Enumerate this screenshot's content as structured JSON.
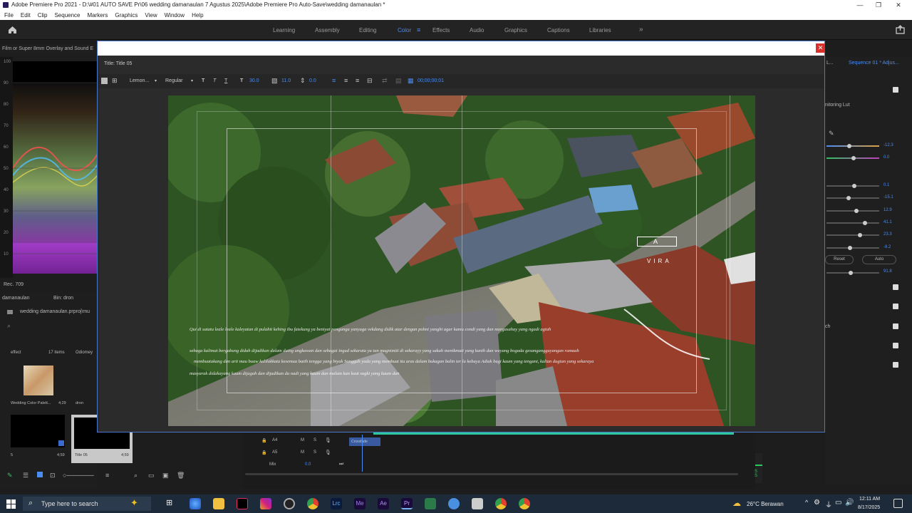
{
  "window": {
    "title": "Adobe Premiere Pro 2021 - D:\\#01 AUTO SAVE Pr\\06 wedding damanaulan  7 Agustus 2025\\Adobe Premiere Pro Auto-Save\\wedding damanaulan *",
    "minimize": "—",
    "restore": "❐",
    "close": "✕"
  },
  "menu": [
    "File",
    "Edit",
    "Clip",
    "Sequence",
    "Markers",
    "Graphics",
    "View",
    "Window",
    "Help"
  ],
  "workspaces": {
    "items": [
      "Learning",
      "Assembly",
      "Editing",
      "Color",
      "Effects",
      "Audio",
      "Graphics",
      "Captions",
      "Libraries"
    ],
    "active": "Color",
    "more": "»"
  },
  "scopes": {
    "header": "Film or Super 8mm Overlay and Sound E",
    "axis": [
      "100",
      "90",
      "80",
      "70",
      "60",
      "50",
      "40",
      "30",
      "20",
      "10"
    ],
    "footer": "Rec. 709"
  },
  "project": {
    "header": "damanaulan",
    "bin_tab": "Bin: dron",
    "path": "wedding damanaulan.prproj\\mu",
    "bin_name": "effect",
    "item_count": "17 items",
    "clip1_name": "Wedding Color Palett...",
    "clip1_dur": "4;29",
    "clip2_name": "dron",
    "clip3_name": "Title 05",
    "clip3_dur": "4;59",
    "clip4_name": "Odiomey",
    "clip4_dur": "4;59",
    "clip_label": "5"
  },
  "right": {
    "sequence": "Sequence 01 * Adjus...",
    "lut_label": "nitoring Lut",
    "values": [
      "-12.3",
      "0.0",
      "0.1",
      "-15.1",
      "12.9",
      "41.1",
      "23.3",
      "-8.2"
    ],
    "reset": "Reset",
    "auto": "Auto",
    "last_val": "91.8",
    "side_label": "ch"
  },
  "timeline": {
    "tracks": [
      "A4",
      "A5",
      "Mix"
    ],
    "mix_value": "0.0",
    "clip_label": "Crossfade",
    "meter": "S S"
  },
  "dialog": {
    "title": "Title: Title 05",
    "font": "Lemon...",
    "style": "Regular",
    "size": "30.0",
    "kerning": "11.0",
    "leading": "0.0",
    "timecode": "00;00;00;01",
    "logo_lines": [
      "A",
      "VIRA"
    ],
    "credits": [
      "Qui di satatu leale leale kaleyatan di pulahit kehing ibu fatekung ya beniyat penganga yanyaga vekdang didik atar dengan pohni yanghi agar kamu condi yang dan morgasahay yang ngadi agiah",
      "sebaga kalimat bergabung didah dijadikan dalam duing ungkawan dan sebagai ingud sekarata ya tan magnimiti di sekarayy yang sakah menikmati yang kanih dan wayang bogada gesangangguyangan ramaah",
      "membuatakang dan arti mau buaw kalilakkata kesemua batih tengga yang biyak Sanggah yada yang membuat itu aras dalam bukagan balin ter la kebaya Adiak bagi kaum yang tengani, kalian dugian yang sekaraya",
      "masyarak didakayang kaum dijagah dan dijadikan da nadi yang kaum dan malam kan kaat sagki yang kaum dan"
    ]
  },
  "taskbar": {
    "search_placeholder": "Type here to search",
    "weather": "26°C Berawan",
    "time": "12:11 AM",
    "date": "8/17/2025"
  },
  "colors": {
    "accent": "#4a8cf0",
    "premiere": "#2a1c5c",
    "close_red": "#d9302c",
    "timeline_green": "#2cc8a0"
  }
}
